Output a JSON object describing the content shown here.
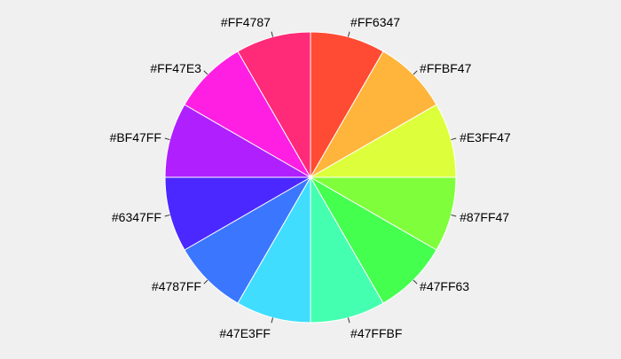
{
  "chart_data": {
    "type": "pie",
    "title": "",
    "start_direction": "top",
    "rotation": "clockwise",
    "slices": [
      {
        "label": "#FF6347",
        "value": 1,
        "color": "#FF4B33"
      },
      {
        "label": "#FFBF47",
        "value": 1,
        "color": "#FFB53B"
      },
      {
        "label": "#E3FF47",
        "value": 1,
        "color": "#DDFF3B"
      },
      {
        "label": "#87FF47",
        "value": 1,
        "color": "#7FFF3B"
      },
      {
        "label": "#47FF63",
        "value": 1,
        "color": "#45FF4F"
      },
      {
        "label": "#47FFBF",
        "value": 1,
        "color": "#45FFB0"
      },
      {
        "label": "#47E3FF",
        "value": 1,
        "color": "#40DDFF"
      },
      {
        "label": "#4787FF",
        "value": 1,
        "color": "#3B76FF"
      },
      {
        "label": "#6347FF",
        "value": 1,
        "color": "#4B28FF"
      },
      {
        "label": "#BF47FF",
        "value": 1,
        "color": "#B020FF"
      },
      {
        "label": "#FF47E3",
        "value": 1,
        "color": "#FF1FE3"
      },
      {
        "label": "#FF4787",
        "value": 1,
        "color": "#FF2A78"
      }
    ],
    "legend": "none",
    "slice_border_color": "#ffffff",
    "background": "#f0f0f0"
  }
}
